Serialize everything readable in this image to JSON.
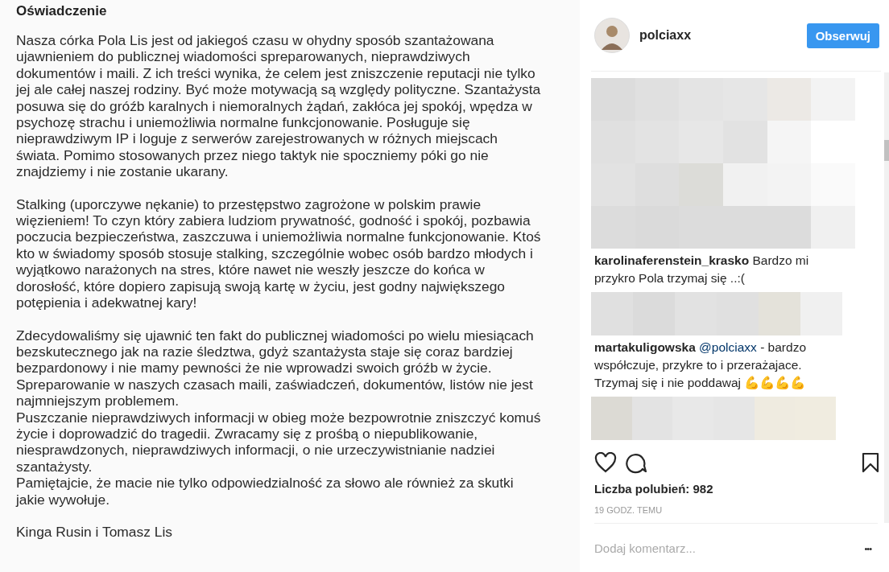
{
  "document": {
    "title": "Oświadczenie",
    "paragraphs": [
      [
        "Nasza córka Pola Lis jest od jakiegoś czasu w ohydny sposób szantażowana",
        "ujawnieniem do publicznej wiadomości spreparowanych, nieprawdziwych",
        "dokumentów i maili. Z ich treści wynika, że celem jest zniszczenie reputacji nie tylko",
        "jej ale całej naszej rodziny. Być może motywacją są względy polityczne. Szantażysta",
        "posuwa się do gróźb karalnych i niemoralnych żądań, zakłóca jej spokój, wpędza w",
        "psychozę strachu i uniemożliwia normalne funkcjonowanie. Posługuje się",
        "nieprawdziwym IP i loguje z serwerów zarejestrowanych w różnych miejscach",
        "świata. Pomimo stosowanych przez niego taktyk nie spoczniemy póki go nie",
        "znajdziemy i nie zostanie ukarany."
      ],
      [
        "Stalking (uporczywe nękanie) to przestępstwo zagrożone w polskim prawie",
        "więzieniem! To czyn który zabiera ludziom prywatność, godność i spokój, pozbawia",
        "poczucia bezpieczeństwa, zaszczuwa i uniemożliwia normalne funkcjonowanie. Ktoś",
        "kto w świadomy sposób stosuje stalking, szczególnie wobec osób bardzo młodych i",
        "wyjątkowo narażonych na stres, które nawet nie weszły jeszcze do końca w",
        "dorosłość, które dopiero zapisują swoją kartę w życiu, jest godny największego",
        "potępienia i adekwatnej kary!"
      ],
      [
        "Zdecydowaliśmy się ujawnić ten fakt do publicznej wiadomości po wielu miesiącach",
        "bezskutecznego jak na razie śledztwa, gdyż szantażysta staje się coraz bardziej",
        "bezpardonowy i nie mamy pewności że nie wprowadzi swoich gróźb w życie.",
        "Spreparowanie w naszych czasach maili, zaświadczeń, dokumentów, listów nie jest",
        "najmniejszym problemem.",
        "Puszczanie nieprawdziwych informacji w obieg może bezpowrotnie zniszczyć komuś",
        "życie i doprowadzić do tragedii. Zwracamy się z prośbą o niepublikowanie,",
        "niesprawdzonych, nieprawdziwych informacji, o nie urzeczywistnianie nadziei",
        "szantażysty.",
        "Pamiętajcie, że macie nie tylko odpowiedzialność za słowo ale również za skutki",
        "jakie wywołuje."
      ],
      [
        "Kinga Rusin i Tomasz Lis"
      ]
    ]
  },
  "header": {
    "username": "polciaxx",
    "follow_button": "Obserwuj"
  },
  "comments": [
    {
      "kind": "pixelated"
    },
    {
      "kind": "comment",
      "user": "karolinaferenstein_krasko",
      "text": "Bardzo mi przykro Pola trzymaj się ..:("
    },
    {
      "kind": "pixelated"
    },
    {
      "kind": "comment",
      "user": "martakuligowska",
      "mention": "@polciaxx",
      "text": "- bardzo współczuje, przykre to i przerażajace. Trzymaj się i nie poddawaj 💪💪💪💪"
    },
    {
      "kind": "pixelated"
    }
  ],
  "likes": "Liczba polubień: 982",
  "time": "19 GODZ. TEMU",
  "comment_field": {
    "placeholder": "Dodaj komentarz..."
  },
  "more": "•••"
}
